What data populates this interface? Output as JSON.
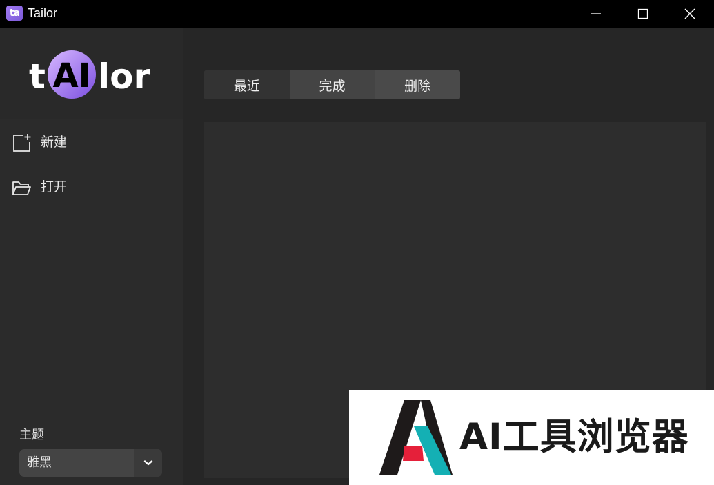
{
  "window": {
    "app_icon_text": "ta",
    "title": "Tailor",
    "controls": [
      "minimize-icon",
      "maximize-icon",
      "close-icon"
    ]
  },
  "sidebar": {
    "logo_text": "tAIlor",
    "items": [
      {
        "label": "新建",
        "icon": "new-file-icon"
      },
      {
        "label": "打开",
        "icon": "folder-open-icon"
      }
    ],
    "theme": {
      "label": "主题",
      "selected": "雅黑",
      "icon": "chevron-down-icon"
    }
  },
  "main": {
    "tabs": [
      {
        "label": "最近",
        "active": true
      },
      {
        "label": "完成",
        "active": false
      },
      {
        "label": "删除",
        "active": false
      }
    ]
  },
  "watermark": {
    "text": "AI工具浏览器"
  },
  "colors": {
    "titlebar": "#000000",
    "sidebar": "#2b2b2b",
    "main": "#262626",
    "panel": "#2d2d2d",
    "logo_gradient_start": "#c7a2ff",
    "logo_gradient_end": "#7b4fe0",
    "watermark_red": "#e5203a",
    "watermark_teal": "#14b0b4"
  }
}
